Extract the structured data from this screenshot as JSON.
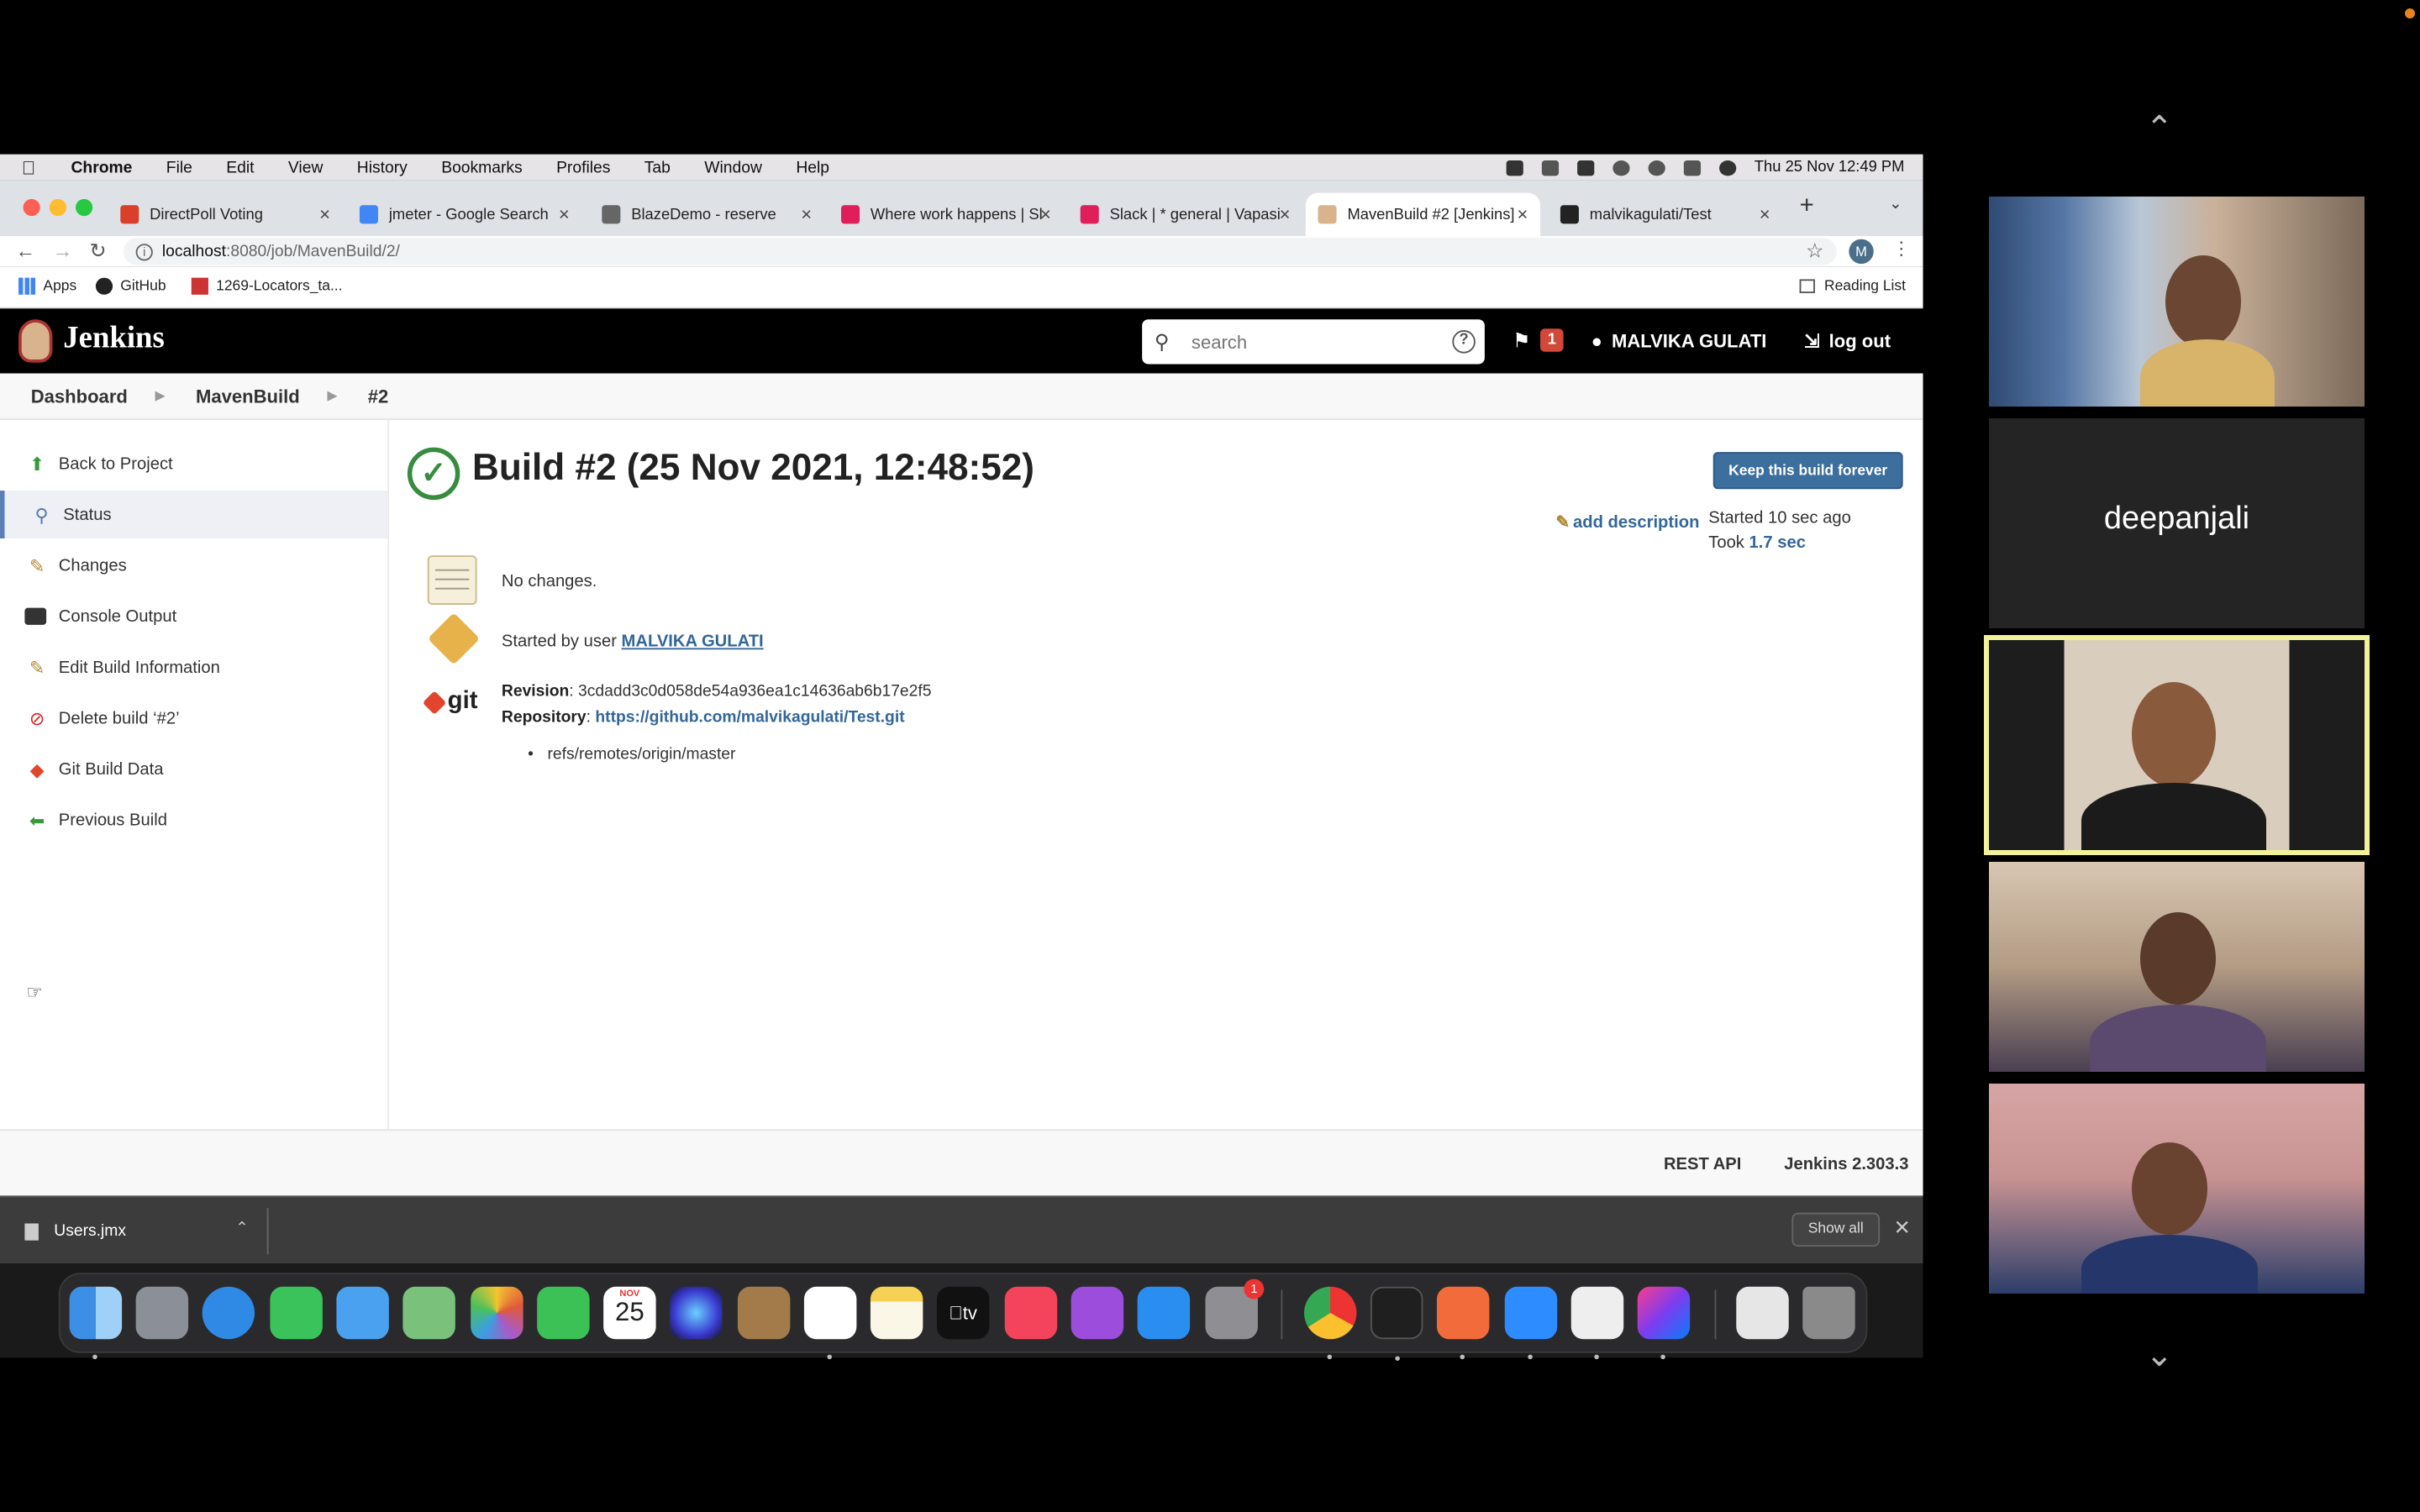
{
  "menubar": {
    "app": "Chrome",
    "items": [
      "File",
      "Edit",
      "View",
      "History",
      "Bookmarks",
      "Profiles",
      "Tab",
      "Window",
      "Help"
    ],
    "clock": "Thu 25 Nov  12:49 PM"
  },
  "tabs": [
    {
      "label": "DirectPoll Voting",
      "color": "#d9402b"
    },
    {
      "label": "jmeter - Google Search",
      "color": "#4285f4"
    },
    {
      "label": "BlazeDemo - reserve",
      "color": "#666666"
    },
    {
      "label": "Where work happens | Sla",
      "color": "#e01e5a"
    },
    {
      "label": "Slack | * general | Vapasi",
      "color": "#e01e5a"
    },
    {
      "label": "MavenBuild #2 [Jenkins]",
      "color": "#d8b38e"
    },
    {
      "label": "malvikagulati/Test",
      "color": "#222222"
    }
  ],
  "address": {
    "host": "localhost",
    "path": ":8080/job/MavenBuild/2/"
  },
  "profile_initial": "M",
  "bookmarks": {
    "apps": "Apps",
    "github": "GitHub",
    "locators": "1269-Locators_ta...",
    "reading_list": "Reading List"
  },
  "jenkins": {
    "title": "Jenkins",
    "search_placeholder": "search",
    "alert_count": "1",
    "user": "MALVIKA GULATI",
    "logout": "log out"
  },
  "breadcrumb": [
    "Dashboard",
    "MavenBuild",
    "#2"
  ],
  "side_tasks": [
    {
      "label": "Back to Project",
      "icon": "up-arrow-icon"
    },
    {
      "label": "Status",
      "icon": "search-icon"
    },
    {
      "label": "Changes",
      "icon": "notepad-icon"
    },
    {
      "label": "Console Output",
      "icon": "terminal-icon"
    },
    {
      "label": "Edit Build Information",
      "icon": "notepad-icon"
    },
    {
      "label": "Delete build ‘#2’",
      "icon": "no-entry-icon"
    },
    {
      "label": "Git Build Data",
      "icon": "git-icon"
    },
    {
      "label": "Previous Build",
      "icon": "left-arrow-icon"
    }
  ],
  "build": {
    "title": "Build #2 (25 Nov 2021, 12:48:52)",
    "keep_label": "Keep this build forever",
    "add_description": "add description",
    "started": "Started 10 sec ago",
    "took_label": "Took",
    "took_value": "1.7 sec",
    "no_changes": "No changes.",
    "started_by": "Started by user",
    "started_by_user": "MALVIKA GULATI",
    "git_label": "git",
    "revision_label": "Revision",
    "revision": "3cdadd3c0d058de54a936ea1c14636ab6b17e2f5",
    "repository_label": "Repository",
    "repository": "https://github.com/malvikagulati/Test.git",
    "ref": "refs/remotes/origin/master"
  },
  "footer": {
    "rest_api": "REST API",
    "version": "Jenkins 2.303.3"
  },
  "downloads": {
    "file": "Users.jmx",
    "show_all": "Show all"
  },
  "dock": {
    "calendar_month": "NOV",
    "calendar_day": "25",
    "settings_badge": "1"
  },
  "zoom": {
    "named_participant": "deepanjali"
  }
}
